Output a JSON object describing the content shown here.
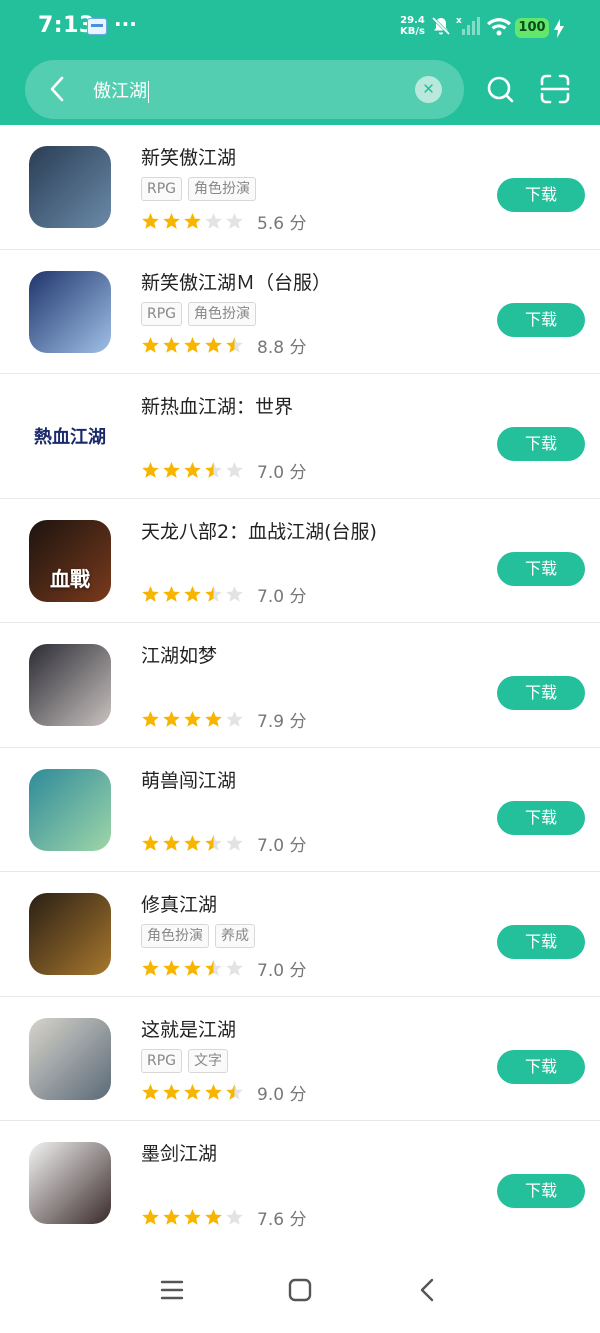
{
  "status": {
    "time": "7:13",
    "dots": "···",
    "net_speed": "29.4",
    "net_unit": "KB/s",
    "battery": "100"
  },
  "search": {
    "query": "傲江湖"
  },
  "download_label": "下载",
  "score_suffix": "分",
  "apps": [
    {
      "name": "新笑傲江湖",
      "tags": [
        "RPG",
        "角色扮演"
      ],
      "rating": 3,
      "score": "5.6",
      "icon_colors": [
        "#2a3d55",
        "#6b8aa8"
      ],
      "icon_text": ""
    },
    {
      "name": "新笑傲江湖Ｍ（台服）",
      "tags": [
        "RPG",
        "角色扮演"
      ],
      "rating": 4.5,
      "score": "8.8",
      "icon_colors": [
        "#20356b",
        "#9fc0e8"
      ],
      "icon_text": ""
    },
    {
      "name": "新热血江湖：世界",
      "tags": [],
      "rating": 3.5,
      "score": "7.0",
      "icon_colors": [
        "#ffffff",
        "#ffffff"
      ],
      "icon_text": "熱血江湖"
    },
    {
      "name": "天龙八部2：血战江湖(台服)",
      "tags": [],
      "rating": 3.5,
      "score": "7.0",
      "icon_colors": [
        "#1c1410",
        "#7a3a1c"
      ],
      "icon_text": "血戰"
    },
    {
      "name": "江湖如梦",
      "tags": [],
      "rating": 4,
      "score": "7.9",
      "icon_colors": [
        "#2b2b33",
        "#c9c2c0"
      ],
      "icon_text": ""
    },
    {
      "name": "萌兽闯江湖",
      "tags": [],
      "rating": 3.5,
      "score": "7.0",
      "icon_colors": [
        "#2e8a9a",
        "#9fd6a8"
      ],
      "icon_text": ""
    },
    {
      "name": "修真江湖",
      "tags": [
        "角色扮演",
        "养成"
      ],
      "rating": 3.5,
      "score": "7.0",
      "icon_colors": [
        "#2a1f15",
        "#a8782e"
      ],
      "icon_text": ""
    },
    {
      "name": "这就是江湖",
      "tags": [
        "RPG",
        "文字"
      ],
      "rating": 4.5,
      "score": "9.0",
      "icon_colors": [
        "#d8d4cc",
        "#5a6a78"
      ],
      "icon_text": ""
    },
    {
      "name": "墨剑江湖",
      "tags": [],
      "rating": 4,
      "score": "7.6",
      "icon_colors": [
        "#f3f3f3",
        "#3a2a2a"
      ],
      "icon_text": ""
    }
  ],
  "colors": {
    "primary": "#24c09c",
    "star": "#f7b500",
    "star_empty": "#e3e3e3"
  }
}
